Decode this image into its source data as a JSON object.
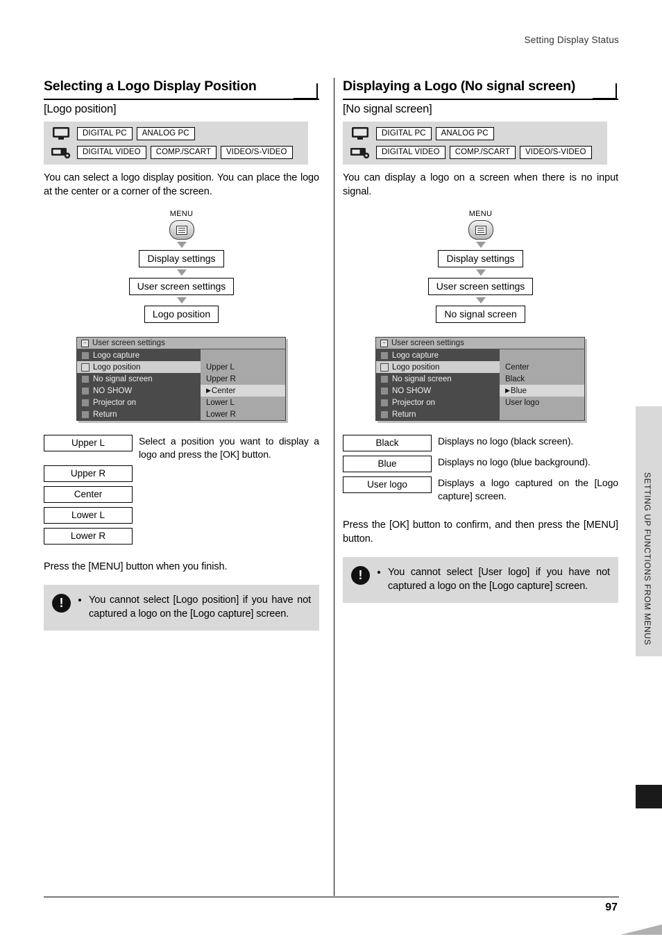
{
  "page": {
    "running_head": "Setting Display Status",
    "folio": "97",
    "side_tab": "SETTING UP FUNCTIONS FROM MENUS"
  },
  "left": {
    "title": "Selecting a Logo Display Position",
    "subtitle": "[Logo position]",
    "signals": {
      "row1": [
        "DIGITAL PC",
        "ANALOG PC"
      ],
      "row2": [
        "DIGITAL VIDEO",
        "COMP./SCART",
        "VIDEO/S-VIDEO"
      ]
    },
    "intro": "You can select a logo display position. You can place the logo at the center or a corner of the screen.",
    "flow": {
      "menu_label": "MENU",
      "step1": "Display settings",
      "step2": "User screen settings",
      "step3": "Logo position"
    },
    "osd": {
      "title": "User screen settings",
      "rows": [
        {
          "label": "Logo capture",
          "value": ""
        },
        {
          "label": "Logo position",
          "value": "Upper L"
        },
        {
          "label": "No signal screen",
          "value": "Upper R"
        },
        {
          "label": "NO SHOW",
          "value": "Center"
        },
        {
          "label": "Projector on",
          "value": "Lower L"
        },
        {
          "label": "Return",
          "value": "Lower R"
        }
      ]
    },
    "options": [
      {
        "label": "Upper L",
        "desc": "Select a position you want to display a logo and press the [OK] button."
      },
      {
        "label": "Upper R",
        "desc": ""
      },
      {
        "label": "Center",
        "desc": ""
      },
      {
        "label": "Lower L",
        "desc": ""
      },
      {
        "label": "Lower R",
        "desc": ""
      }
    ],
    "after_text": "Press the [MENU] button when you finish.",
    "note": "You cannot select [Logo position] if you have not captured a logo on the [Logo capture] screen."
  },
  "right": {
    "title": "Displaying a Logo (No signal screen)",
    "subtitle": "[No signal screen]",
    "signals": {
      "row1": [
        "DIGITAL PC",
        "ANALOG PC"
      ],
      "row2": [
        "DIGITAL VIDEO",
        "COMP./SCART",
        "VIDEO/S-VIDEO"
      ]
    },
    "intro": "You can display a logo on a screen when there is no input signal.",
    "flow": {
      "menu_label": "MENU",
      "step1": "Display settings",
      "step2": "User screen settings",
      "step3": "No signal screen"
    },
    "osd": {
      "title": "User screen settings",
      "rows": [
        {
          "label": "Logo capture",
          "value": ""
        },
        {
          "label": "Logo position",
          "value": "Center"
        },
        {
          "label": "No signal screen",
          "value": "Black"
        },
        {
          "label": "NO SHOW",
          "value": "Blue"
        },
        {
          "label": "Projector on",
          "value": "User logo"
        },
        {
          "label": "Return",
          "value": ""
        }
      ]
    },
    "options": [
      {
        "label": "Black",
        "desc": "Displays no logo (black screen)."
      },
      {
        "label": "Blue",
        "desc": "Displays no logo (blue background)."
      },
      {
        "label": "User logo",
        "desc": "Displays a logo captured on the [Logo capture] screen."
      }
    ],
    "after_text": "Press the [OK] button to confirm, and then press the [MENU] button.",
    "note": "You cannot select [User logo] if you have not captured a logo on the [Logo capture] screen."
  }
}
